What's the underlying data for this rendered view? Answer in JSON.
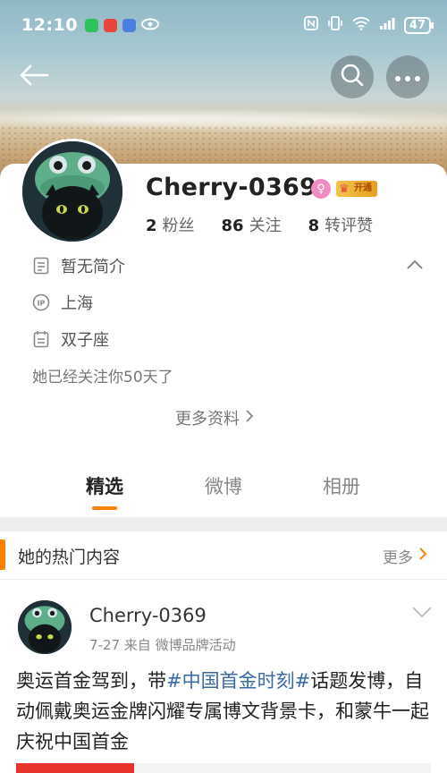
{
  "status_bar": {
    "time": "12:10",
    "battery": "47"
  },
  "profile": {
    "name": "Cherry-0369",
    "gender_symbol": "♀",
    "vip_label": "开通",
    "stats": [
      {
        "count": "2",
        "label": "粉丝"
      },
      {
        "count": "86",
        "label": "关注"
      },
      {
        "count": "8",
        "label": "转评赞"
      }
    ],
    "bio": "暂无简介",
    "ip_icon": "IP",
    "location": "上海",
    "zodiac": "双子座",
    "follow_note": "她已经关注你50天了",
    "more_info": "更多资料"
  },
  "tabs": [
    "精选",
    "微博",
    "相册"
  ],
  "hot_section": {
    "title": "她的热门内容",
    "more": "更多"
  },
  "post": {
    "author": "Cherry-0369",
    "meta": "7-27  来自 微博品牌活动",
    "text_before": "奥运首金驾到，带",
    "topic": "#中国首金时刻#",
    "text_after": "话题发博，自动佩戴奥运金牌闪耀专属博文背景卡，和蒙牛一起庆祝中国首金"
  },
  "colors": {
    "accent": "#ff8200",
    "topic": "#3a6aa5",
    "vip_gold": "#f3c24f",
    "gender_pink": "#f08bc4"
  }
}
